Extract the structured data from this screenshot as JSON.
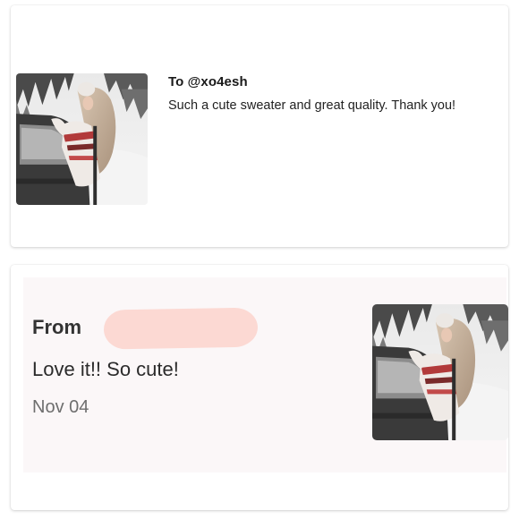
{
  "sent_card": {
    "to_label": "To @xo4esh",
    "message": "Such a cute sweater and great quality. Thank you!",
    "photo_icon": "product-photo-icon"
  },
  "received_card": {
    "from_label": "From",
    "comment": "Love it!! So cute!",
    "date": "Nov 04",
    "photo_icon": "product-photo-icon",
    "redaction_color": "#fcd9d3"
  }
}
